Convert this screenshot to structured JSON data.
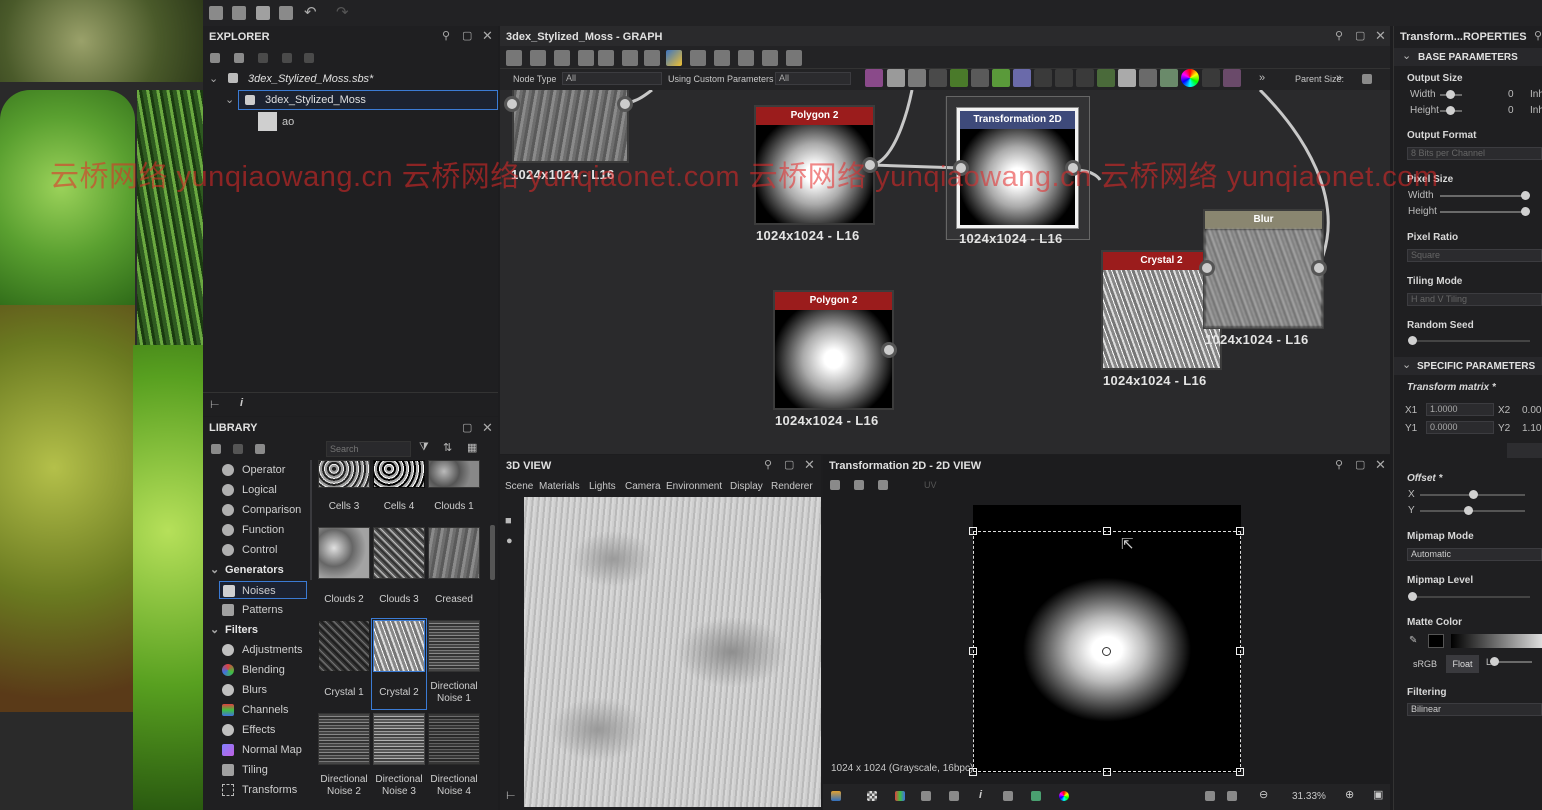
{
  "top_toolbar": {
    "icons": [
      "new-graph-icon",
      "new-package-icon",
      "open-folder-icon",
      "save-icon",
      "undo-icon",
      "redo-icon"
    ]
  },
  "explorer": {
    "title": "EXPLORER",
    "package": "3dex_Stylized_Moss.sbs*",
    "graph": "3dex_Stylized_Moss",
    "resource": "ao"
  },
  "graph": {
    "title": "3dex_Stylized_Moss - GRAPH",
    "node_type_label": "Node Type",
    "node_type_value": "All",
    "custom_params_label": "Using Custom Parameters",
    "custom_params_value": "All",
    "parent_size_label": "Parent Size:",
    "nodes": [
      {
        "name": "",
        "size": "1024x1024 - L16"
      },
      {
        "name": "Polygon 2",
        "size": "1024x1024 - L16"
      },
      {
        "name": "Transformation 2D",
        "size": "1024x1024 - L16"
      },
      {
        "name": "Polygon 2",
        "size": "1024x1024 - L16"
      },
      {
        "name": "Crystal 2",
        "size": "1024x1024 - L16"
      },
      {
        "name": "Blur",
        "size": "1024x1024 - L16"
      }
    ]
  },
  "library": {
    "title": "LIBRARY",
    "search_placeholder": "Search",
    "categories": [
      {
        "label": "Operator",
        "icon": "operator-icon"
      },
      {
        "label": "Logical",
        "icon": "logical-icon"
      },
      {
        "label": "Comparison",
        "icon": "comparison-icon"
      },
      {
        "label": "Function",
        "icon": "function-icon"
      },
      {
        "label": "Control",
        "icon": "control-icon"
      },
      {
        "label": "Generators",
        "icon": ""
      },
      {
        "label": "Noises",
        "icon": "noises-icon"
      },
      {
        "label": "Patterns",
        "icon": "patterns-icon"
      },
      {
        "label": "Filters",
        "icon": ""
      },
      {
        "label": "Adjustments",
        "icon": "adjustments-icon"
      },
      {
        "label": "Blending",
        "icon": "blending-icon"
      },
      {
        "label": "Blurs",
        "icon": "blurs-icon"
      },
      {
        "label": "Channels",
        "icon": "channels-icon"
      },
      {
        "label": "Effects",
        "icon": "effects-icon"
      },
      {
        "label": "Normal Map",
        "icon": "normal-map-icon"
      },
      {
        "label": "Tiling",
        "icon": "tiling-icon"
      },
      {
        "label": "Transforms",
        "icon": "transforms-icon"
      }
    ],
    "thumbs": [
      {
        "label": "Cells 3"
      },
      {
        "label": "Cells 4"
      },
      {
        "label": "Clouds 1"
      },
      {
        "label": "Clouds 2"
      },
      {
        "label": "Clouds 3"
      },
      {
        "label": "Creased"
      },
      {
        "label": "Crystal 1"
      },
      {
        "label": "Crystal 2"
      },
      {
        "label": "Directional Noise 1"
      },
      {
        "label": "Directional Noise 2"
      },
      {
        "label": "Directional Noise 3"
      },
      {
        "label": "Directional Noise 4"
      }
    ]
  },
  "view3d": {
    "title": "3D VIEW",
    "menu": [
      "Scene",
      "Materials",
      "Lights",
      "Camera",
      "Environment",
      "Display",
      "Renderer"
    ]
  },
  "view2d": {
    "title": "Transformation 2D - 2D VIEW",
    "uv_label": "UV",
    "status": "1024 x 1024 (Grayscale, 16bpc)",
    "zoom": "31.33%"
  },
  "properties": {
    "title": "Transform...ROPERTIES",
    "base_header": "BASE PARAMETERS",
    "output_size": "Output Size",
    "width_label": "Width",
    "height_label": "Height",
    "width_value": "0",
    "height_value": "0",
    "inherit_a": "Inh",
    "inherit_b": "Inh",
    "output_format": "Output Format",
    "output_format_value": "8 Bits per Channel",
    "pixel_size": "Pixel Size",
    "pixel_ratio": "Pixel Ratio",
    "pixel_ratio_value": "Square",
    "tiling_mode": "Tiling Mode",
    "tiling_mode_value": "H and V Tiling",
    "random_seed": "Random Seed",
    "specific_header": "SPECIFIC PARAMETERS",
    "transform_matrix": "Transform matrix *",
    "x1_label": "X1",
    "x1_value": "1.0000",
    "x2_label": "X2",
    "x2_value": "0.00",
    "y1_label": "Y1",
    "y1_value": "0.0000",
    "y2_label": "Y2",
    "y2_value": "1.10",
    "offset": "Offset *",
    "offset_x": "X",
    "offset_y": "Y",
    "mipmap_mode": "Mipmap Mode",
    "mipmap_mode_value": "Automatic",
    "mipmap_level": "Mipmap Level",
    "matte_color": "Matte Color",
    "srgb": "sRGB",
    "float": "Float",
    "matte_l": "L",
    "filtering": "Filtering",
    "filtering_value": "Bilinear"
  },
  "watermark": "云桥网络 yunqiaowang.cn 云桥网络 yunqiaonet.com 云桥网络 yunqiaowang.cn 云桥网络 yunqiaonet.com",
  "colors": {
    "node_red": "#9b1c1c",
    "node_blue": "#3e4a7a",
    "node_blur": "#8a8670",
    "accent": "#3b7bd4"
  }
}
